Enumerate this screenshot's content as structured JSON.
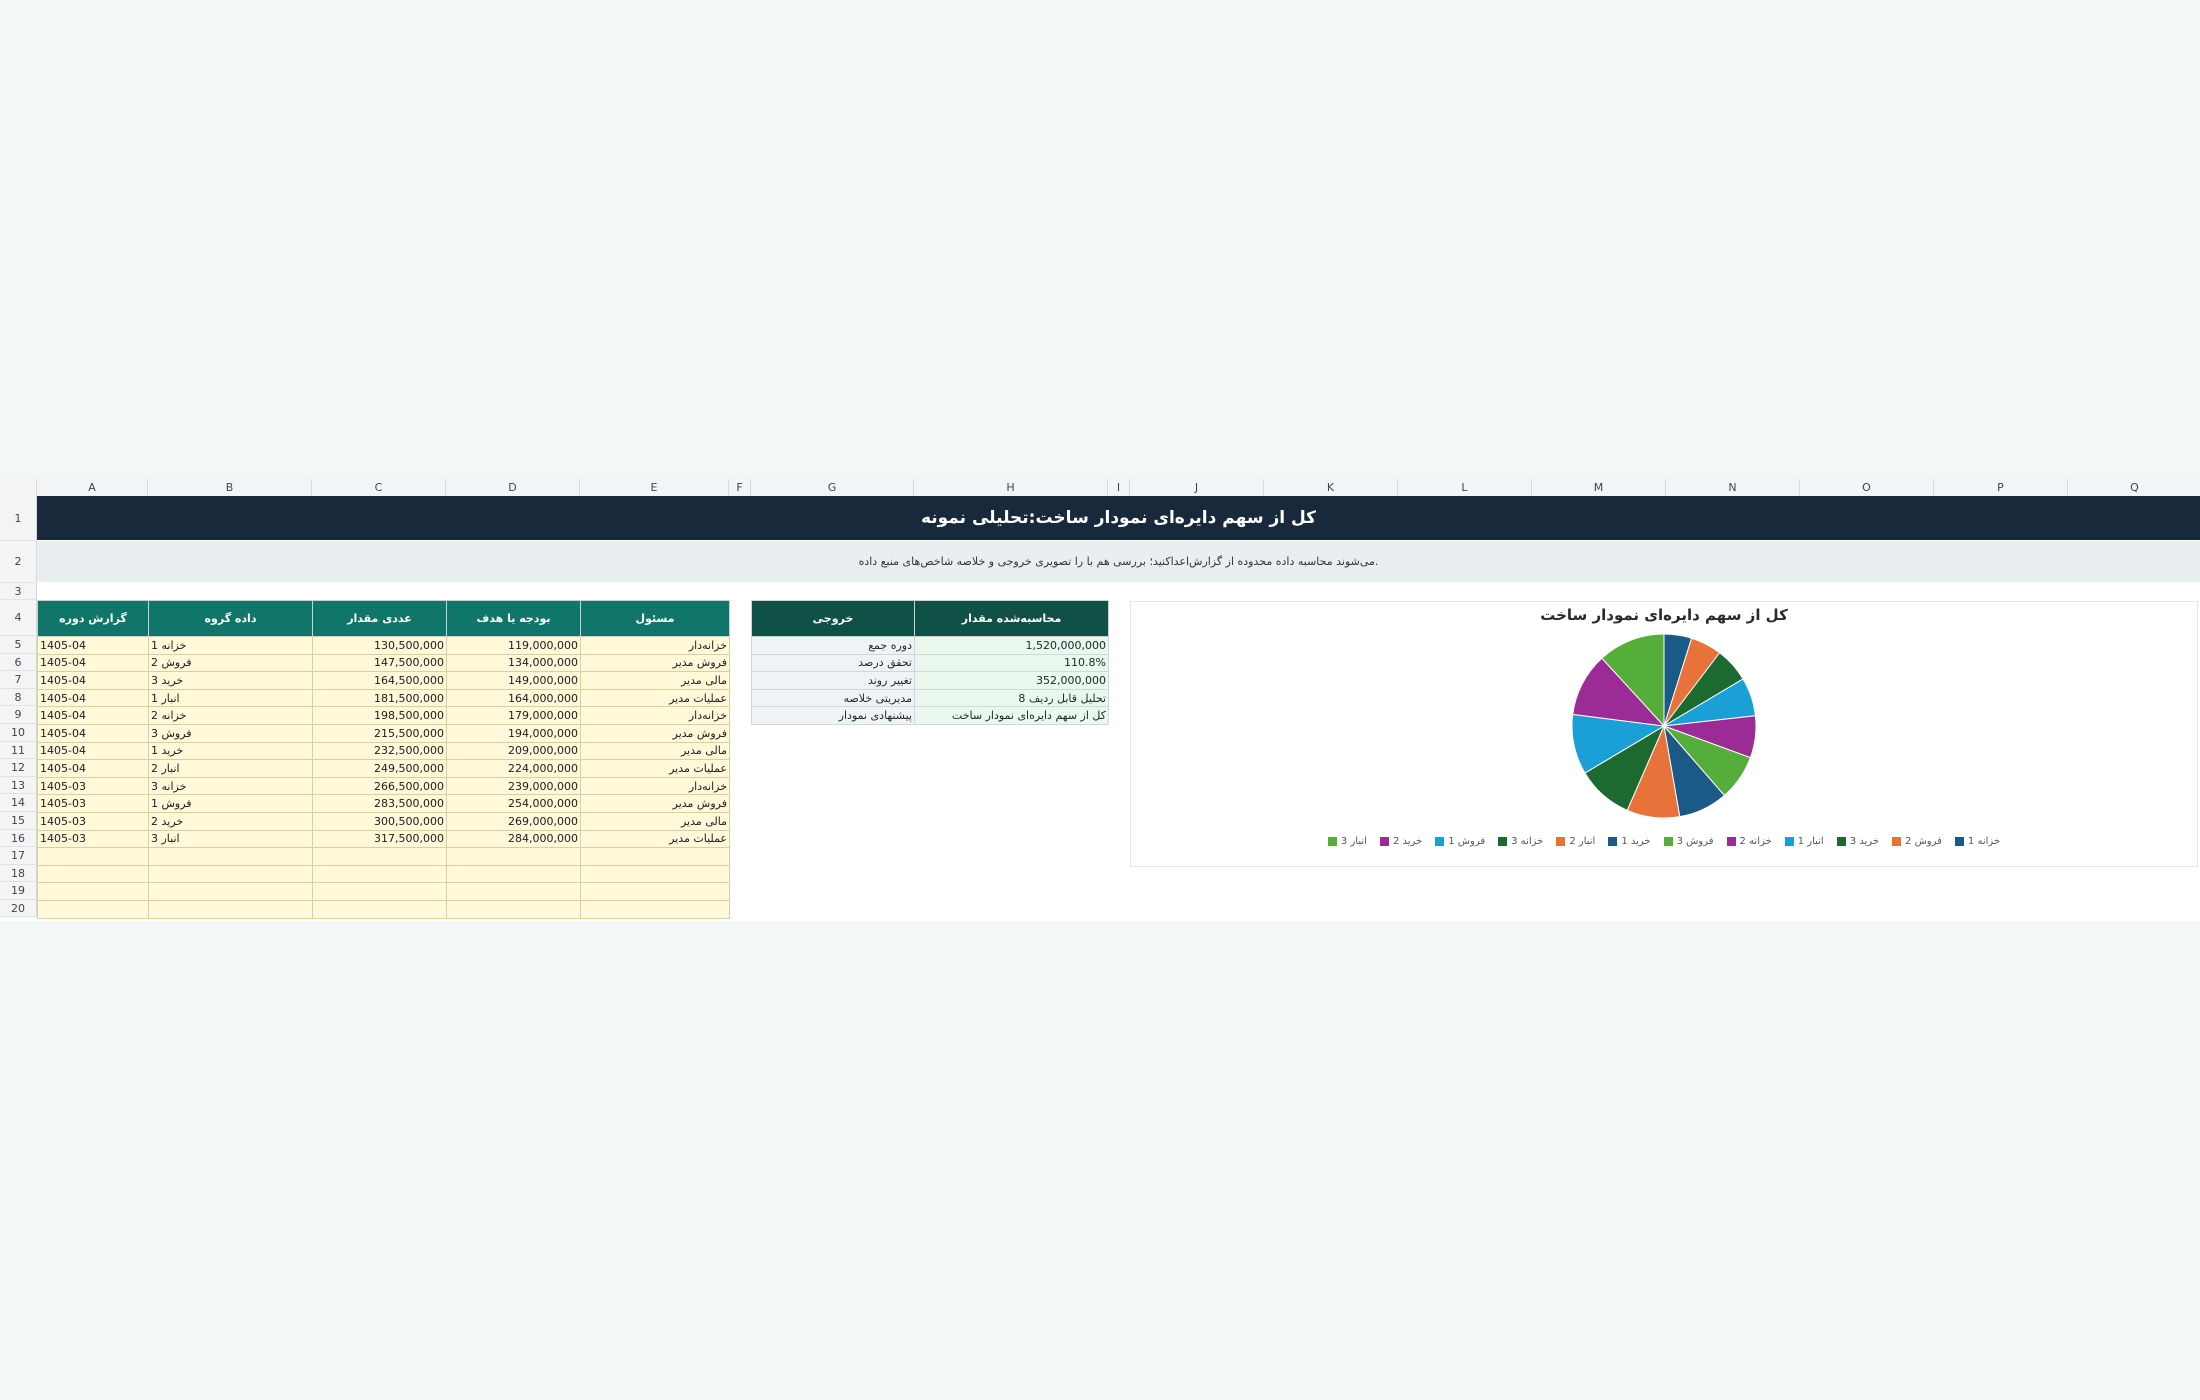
{
  "sheet": {
    "columns": [
      "A",
      "B",
      "C",
      "D",
      "E",
      "F",
      "G",
      "H",
      "I",
      "J",
      "K",
      "L",
      "M",
      "N",
      "O",
      "P",
      "Q"
    ],
    "rows": [
      "1",
      "2",
      "3",
      "4",
      "5",
      "6",
      "7",
      "8",
      "9",
      "10",
      "11",
      "12",
      "13",
      "14",
      "15",
      "16",
      "17",
      "18",
      "19",
      "20"
    ],
    "title": "کل از سهم دایره‌ای نمودار ساخت:تحلیلی نمونه",
    "subtitle": ".می‌شوند محاسبه داده محدوده از گزارش‌اعداکنید؛ بررسی هم با را تصویری خروجی و خلاصه شاخص‌های منبع داده"
  },
  "data_table": {
    "headers": [
      "گزارش دوره",
      "داده گروه",
      "عددی مقدار",
      "بودجه یا هدف",
      "مسئول"
    ],
    "rows": [
      [
        "1405-04",
        "خزانه 1",
        "130,500,000",
        "119,000,000",
        "خزانه‌دار"
      ],
      [
        "1405-04",
        "فروش 2",
        "147,500,000",
        "134,000,000",
        "فروش مدیر"
      ],
      [
        "1405-04",
        "خرید 3",
        "164,500,000",
        "149,000,000",
        "مالی مدیر"
      ],
      [
        "1405-04",
        "انبار 1",
        "181,500,000",
        "164,000,000",
        "عملیات مدیر"
      ],
      [
        "1405-04",
        "خزانه 2",
        "198,500,000",
        "179,000,000",
        "خزانه‌دار"
      ],
      [
        "1405-04",
        "فروش 3",
        "215,500,000",
        "194,000,000",
        "فروش مدیر"
      ],
      [
        "1405-04",
        "خرید 1",
        "232,500,000",
        "209,000,000",
        "مالی مدیر"
      ],
      [
        "1405-04",
        "انبار 2",
        "249,500,000",
        "224,000,000",
        "عملیات مدیر"
      ],
      [
        "1405-03",
        "خزانه 3",
        "266,500,000",
        "239,000,000",
        "خزانه‌دار"
      ],
      [
        "1405-03",
        "فروش 1",
        "283,500,000",
        "254,000,000",
        "فروش مدیر"
      ],
      [
        "1405-03",
        "خرید 2",
        "300,500,000",
        "269,000,000",
        "مالی مدیر"
      ],
      [
        "1405-03",
        "انبار 3",
        "317,500,000",
        "284,000,000",
        "عملیات مدیر"
      ],
      [
        "",
        "",
        "",
        "",
        ""
      ],
      [
        "",
        "",
        "",
        "",
        ""
      ],
      [
        "",
        "",
        "",
        "",
        ""
      ],
      [
        "",
        "",
        "",
        "",
        ""
      ]
    ]
  },
  "output_table": {
    "headers": [
      "خروجی",
      "محاسبه‌شده مقدار"
    ],
    "rows": [
      [
        "دوره جمع",
        "1,520,000,000"
      ],
      [
        "تحقق درصد",
        "110.8%"
      ],
      [
        "تغییر روند",
        "352,000,000"
      ],
      [
        "مدیریتی خلاصه",
        "تحلیل قابل ردیف 8"
      ],
      [
        "پیشنهادی نمودار",
        "کل از سهم دایره‌ای نمودار ساخت"
      ]
    ]
  },
  "chart_data": {
    "type": "pie",
    "title": "کل از سهم دایره‌ای نمودار ساخت",
    "categories": [
      "خزانه 1",
      "فروش 2",
      "خرید 3",
      "انبار 1",
      "خزانه 2",
      "فروش 3",
      "خرید 1",
      "انبار 2",
      "خزانه 3",
      "فروش 1",
      "خرید 2",
      "انبار 3"
    ],
    "values": [
      130500000,
      147500000,
      164500000,
      181500000,
      198500000,
      215500000,
      232500000,
      249500000,
      266500000,
      283500000,
      300500000,
      317500000
    ],
    "colors": [
      "#1b5a86",
      "#e8733a",
      "#1c6a2f",
      "#1aa0d6",
      "#9b2b95",
      "#55ae3a",
      "#1b5a86",
      "#e8733a",
      "#1c6a2f",
      "#1aa0d6",
      "#9b2b95",
      "#55ae3a"
    ],
    "legend_position": "bottom"
  }
}
